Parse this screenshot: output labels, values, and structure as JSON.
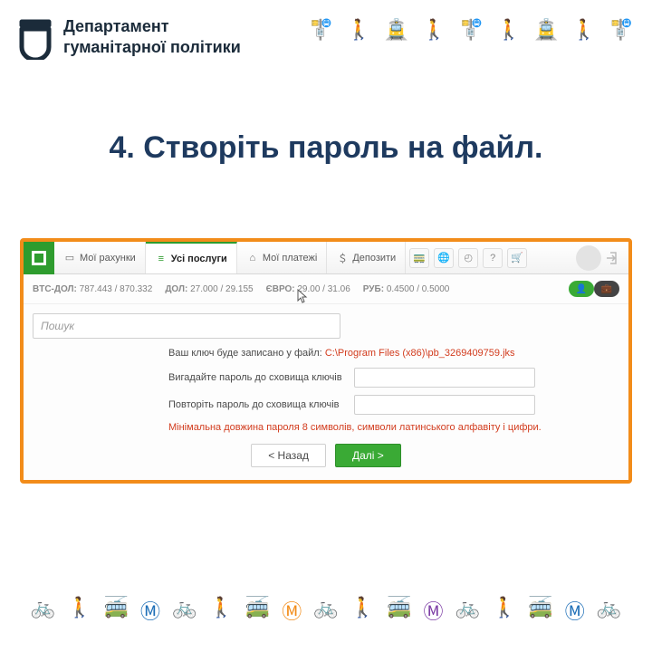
{
  "department": {
    "line1": "Департамент",
    "line2": "гуманітарної політики"
  },
  "top_icons": [
    {
      "name": "stop-icon",
      "glyph": "🚏",
      "color": "#7e3fa6"
    },
    {
      "name": "walk-icon",
      "glyph": "🚶",
      "color": "#f28c1a"
    },
    {
      "name": "bus-icon",
      "glyph": "🚊",
      "color": "#d23c1e"
    },
    {
      "name": "walk2-icon",
      "glyph": "🚶",
      "color": "#f28c1a"
    },
    {
      "name": "stop2-icon",
      "glyph": "🚏",
      "color": "#1e6fb7"
    },
    {
      "name": "walk3-icon",
      "glyph": "🚶",
      "color": "#1e6fb7"
    },
    {
      "name": "bus2-icon",
      "glyph": "🚊",
      "color": "#2e9c2e"
    },
    {
      "name": "walk4-icon",
      "glyph": "🚶",
      "color": "#f28c1a"
    },
    {
      "name": "stop3-icon",
      "glyph": "🚏",
      "color": "#7e3fa6"
    }
  ],
  "title": "4. Створіть пароль на файл.",
  "nav": {
    "accounts": "Мої рахунки",
    "all_services": "Усі послуги",
    "payments": "Мої платежі",
    "deposits": "Депозити"
  },
  "rates": {
    "btc_label": "BTC-ДОЛ:",
    "btc": "787.443 / 870.332",
    "usd_label": "ДОЛ:",
    "usd": "27.000 / 29.155",
    "eur_label": "ЄВРО:",
    "eur": "29.00 / 31.06",
    "rub_label": "РУБ:",
    "rub": "0.4500 / 0.5000"
  },
  "search": {
    "placeholder": "Пошук"
  },
  "form": {
    "info_prefix": "Ваш ключ буде записано у файл: ",
    "info_path": "C:\\Program Files (x86)\\pb_3269409759.jks",
    "pw1_label": "Вигадайте пароль до сховища ключів",
    "pw2_label": "Повторіть пароль до сховища ключів",
    "hint": "Мінімальна довжина пароля 8 символів, символи латинського алфавіту і цифри.",
    "back": "< Назад",
    "next": "Далі >"
  },
  "bottom_icons": [
    {
      "name": "bike-icon",
      "glyph": "🚲",
      "color": "#2e9c2e"
    },
    {
      "name": "walk-icon",
      "glyph": "🚶",
      "color": "#f2c31a"
    },
    {
      "name": "trolley-icon",
      "glyph": "🚎",
      "color": "#7e3fa6"
    },
    {
      "name": "metro-icon",
      "glyph": "Ⓜ",
      "color": "#1e6fb7"
    },
    {
      "name": "bike2-icon",
      "glyph": "🚲",
      "color": "#d23c1e"
    },
    {
      "name": "walk2-icon",
      "glyph": "🚶",
      "color": "#f2c31a"
    },
    {
      "name": "trolley2-icon",
      "glyph": "🚎",
      "color": "#2e9c2e"
    },
    {
      "name": "metro2-icon",
      "glyph": "Ⓜ",
      "color": "#f28c1a"
    },
    {
      "name": "bike3-icon",
      "glyph": "🚲",
      "color": "#2e9c2e"
    },
    {
      "name": "walk3-icon",
      "glyph": "🚶",
      "color": "#f2c31a"
    },
    {
      "name": "trolley3-icon",
      "glyph": "🚎",
      "color": "#1e6fb7"
    },
    {
      "name": "metro3-icon",
      "glyph": "Ⓜ",
      "color": "#7e3fa6"
    },
    {
      "name": "bike4-icon",
      "glyph": "🚲",
      "color": "#d23c1e"
    },
    {
      "name": "walk4-icon",
      "glyph": "🚶",
      "color": "#f2c31a"
    },
    {
      "name": "trolley4-icon",
      "glyph": "🚎",
      "color": "#7e3fa6"
    },
    {
      "name": "metro4-icon",
      "glyph": "Ⓜ",
      "color": "#1e6fb7"
    },
    {
      "name": "bike5-icon",
      "glyph": "🚲",
      "color": "#2e9c2e"
    }
  ]
}
